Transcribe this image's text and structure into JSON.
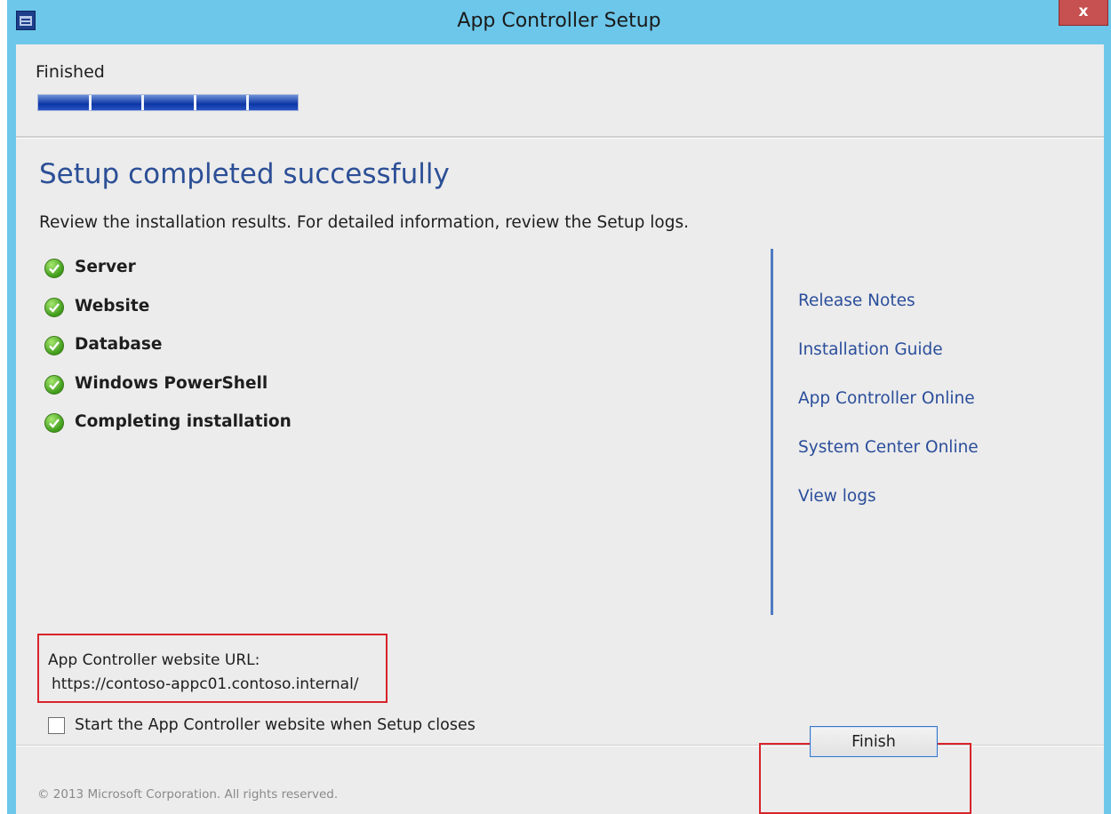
{
  "window": {
    "title": "App Controller Setup",
    "close_label": "x",
    "accent_color": "#6dc7ea"
  },
  "progress": {
    "step_label": "Finished",
    "value_percent": 100,
    "segments": 5
  },
  "main": {
    "heading": "Setup completed successfully",
    "subtext": "Review the installation results. For detailed information, review the Setup logs.",
    "results": [
      {
        "label": "Server",
        "status": "success",
        "icon": "check-icon"
      },
      {
        "label": "Website",
        "status": "success",
        "icon": "check-icon"
      },
      {
        "label": "Database",
        "status": "success",
        "icon": "check-icon"
      },
      {
        "label": "Windows PowerShell",
        "status": "success",
        "icon": "check-icon"
      },
      {
        "label": "Completing installation",
        "status": "success",
        "icon": "check-icon"
      }
    ],
    "links": [
      "Release Notes",
      "Installation Guide",
      "App Controller Online",
      "System Center Online",
      "View logs"
    ]
  },
  "url_section": {
    "label": "App Controller website URL:",
    "value": "https://contoso-appc01.contoso.internal/"
  },
  "start_website_checkbox": {
    "label": "Start the App Controller website when Setup closes",
    "checked": false
  },
  "footer": {
    "copyright": "© 2013 Microsoft Corporation. All rights reserved.",
    "finish_label": "Finish"
  }
}
